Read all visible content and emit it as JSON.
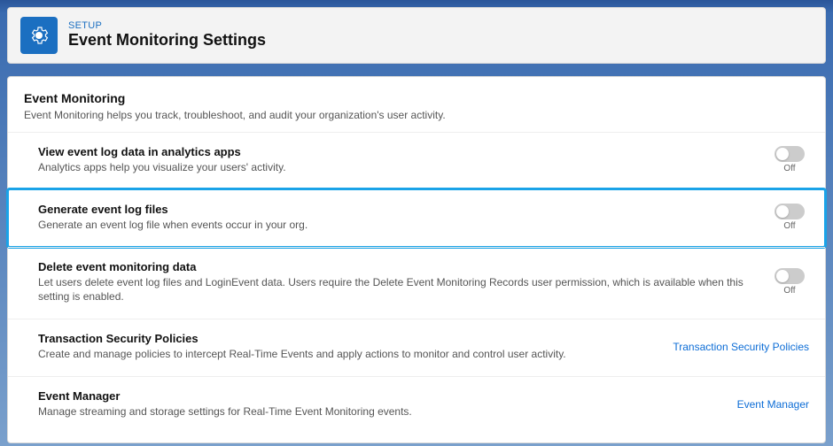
{
  "header": {
    "eyebrow": "SETUP",
    "title": "Event Monitoring Settings"
  },
  "section": {
    "title": "Event Monitoring",
    "subtitle": "Event Monitoring helps you track, troubleshoot, and audit your organization's user activity."
  },
  "rows": {
    "view_analytics": {
      "title": "View event log data in analytics apps",
      "desc": "Analytics apps help you visualize your users' activity.",
      "toggle_state": "Off"
    },
    "generate_logs": {
      "title": "Generate event log files",
      "desc": "Generate an event log file when events occur in your org.",
      "toggle_state": "Off"
    },
    "delete_data": {
      "title": "Delete event monitoring data",
      "desc": "Let users delete event log files and LoginEvent data. Users require the Delete Event Monitoring Records user permission, which is available when this setting is enabled.",
      "toggle_state": "Off"
    },
    "transaction_policies": {
      "title": "Transaction Security Policies",
      "desc": "Create and manage policies to intercept Real-Time Events and apply actions to monitor and control user activity.",
      "link": "Transaction Security Policies"
    },
    "event_manager": {
      "title": "Event Manager",
      "desc": "Manage streaming and storage settings for Real-Time Event Monitoring events.",
      "link": "Event Manager"
    }
  }
}
